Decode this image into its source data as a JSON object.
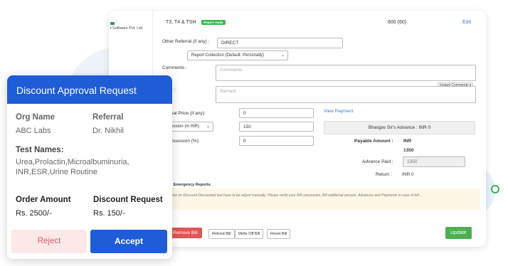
{
  "app": {
    "brand_text": "t Software Pvt. Ltd",
    "header": {
      "tests": "T3, T4 & TSH",
      "status_badge": "Report ready",
      "amount": "600 (60)",
      "edit_label": "Edit"
    },
    "other_referral_label": "Other Referral (if any) :",
    "other_referral_value": "DIRECT",
    "report_collection_value": "Report Collection (Default: Personally)",
    "comments_label": "Comments :",
    "comments_placeholder": "Comments",
    "instant_comments_label": "Instant Comments",
    "remark_label": "mark :",
    "remark_placeholder": "Remark",
    "additional_price_label": "ditional Price (if any):",
    "additional_price_value": "0",
    "concession_type_value": "ncession (in INR)",
    "concession_amount_value": "150",
    "concession_percent_label": "Concession (%):",
    "concession_percent_value": "0",
    "view_payment_label": "View Payment",
    "advance_box": "Bhargav Sir's Advance : INR 0",
    "payable_label": "Payable Amount :",
    "payable_currency": "INR",
    "payable_value": "1350",
    "advance_paid_label": "Advance Paid :",
    "advance_paid_value": "1350",
    "return_label": "Return :",
    "return_value": "INR  0",
    "critical_label": "tical / Emergency Reports.",
    "notice_text": "Concession on Discount Discounted test have to be adjust manually. Please verify your Bill concession, Bill additional amount, Advances and Payments in case of bill ...",
    "buttons": {
      "remove_bill": "Remove Bill",
      "refund_bill": "Refund Bill",
      "write_off_bill": "Write Off Bill",
      "reset_bill": "Reset Bill",
      "update": "Update"
    }
  },
  "card": {
    "title": "Discount Approval Request",
    "org_name_label": "Org Name",
    "org_name_value": "ABC Labs",
    "referral_label": "Referral",
    "referral_value": "Dr. Nikhil",
    "test_names_label": "Test Names:",
    "test_names_value": "Urea,Prolactin,Microalbuminuria, INR,ESR,Urine Routine",
    "order_amount_label": "Order Amount",
    "order_amount_value": "Rs. 2500/-",
    "discount_request_label": "Discount Request",
    "discount_request_value": "Rs. 150/-",
    "reject_label": "Reject",
    "accept_label": "Accept"
  },
  "colors": {
    "primary_blue": "#1f5dd6",
    "reject_bg": "#fbe9ea",
    "reject_text": "#e25563",
    "ready_green": "#3bb54a",
    "update_green": "#4caf50",
    "remove_red": "#e05555"
  }
}
